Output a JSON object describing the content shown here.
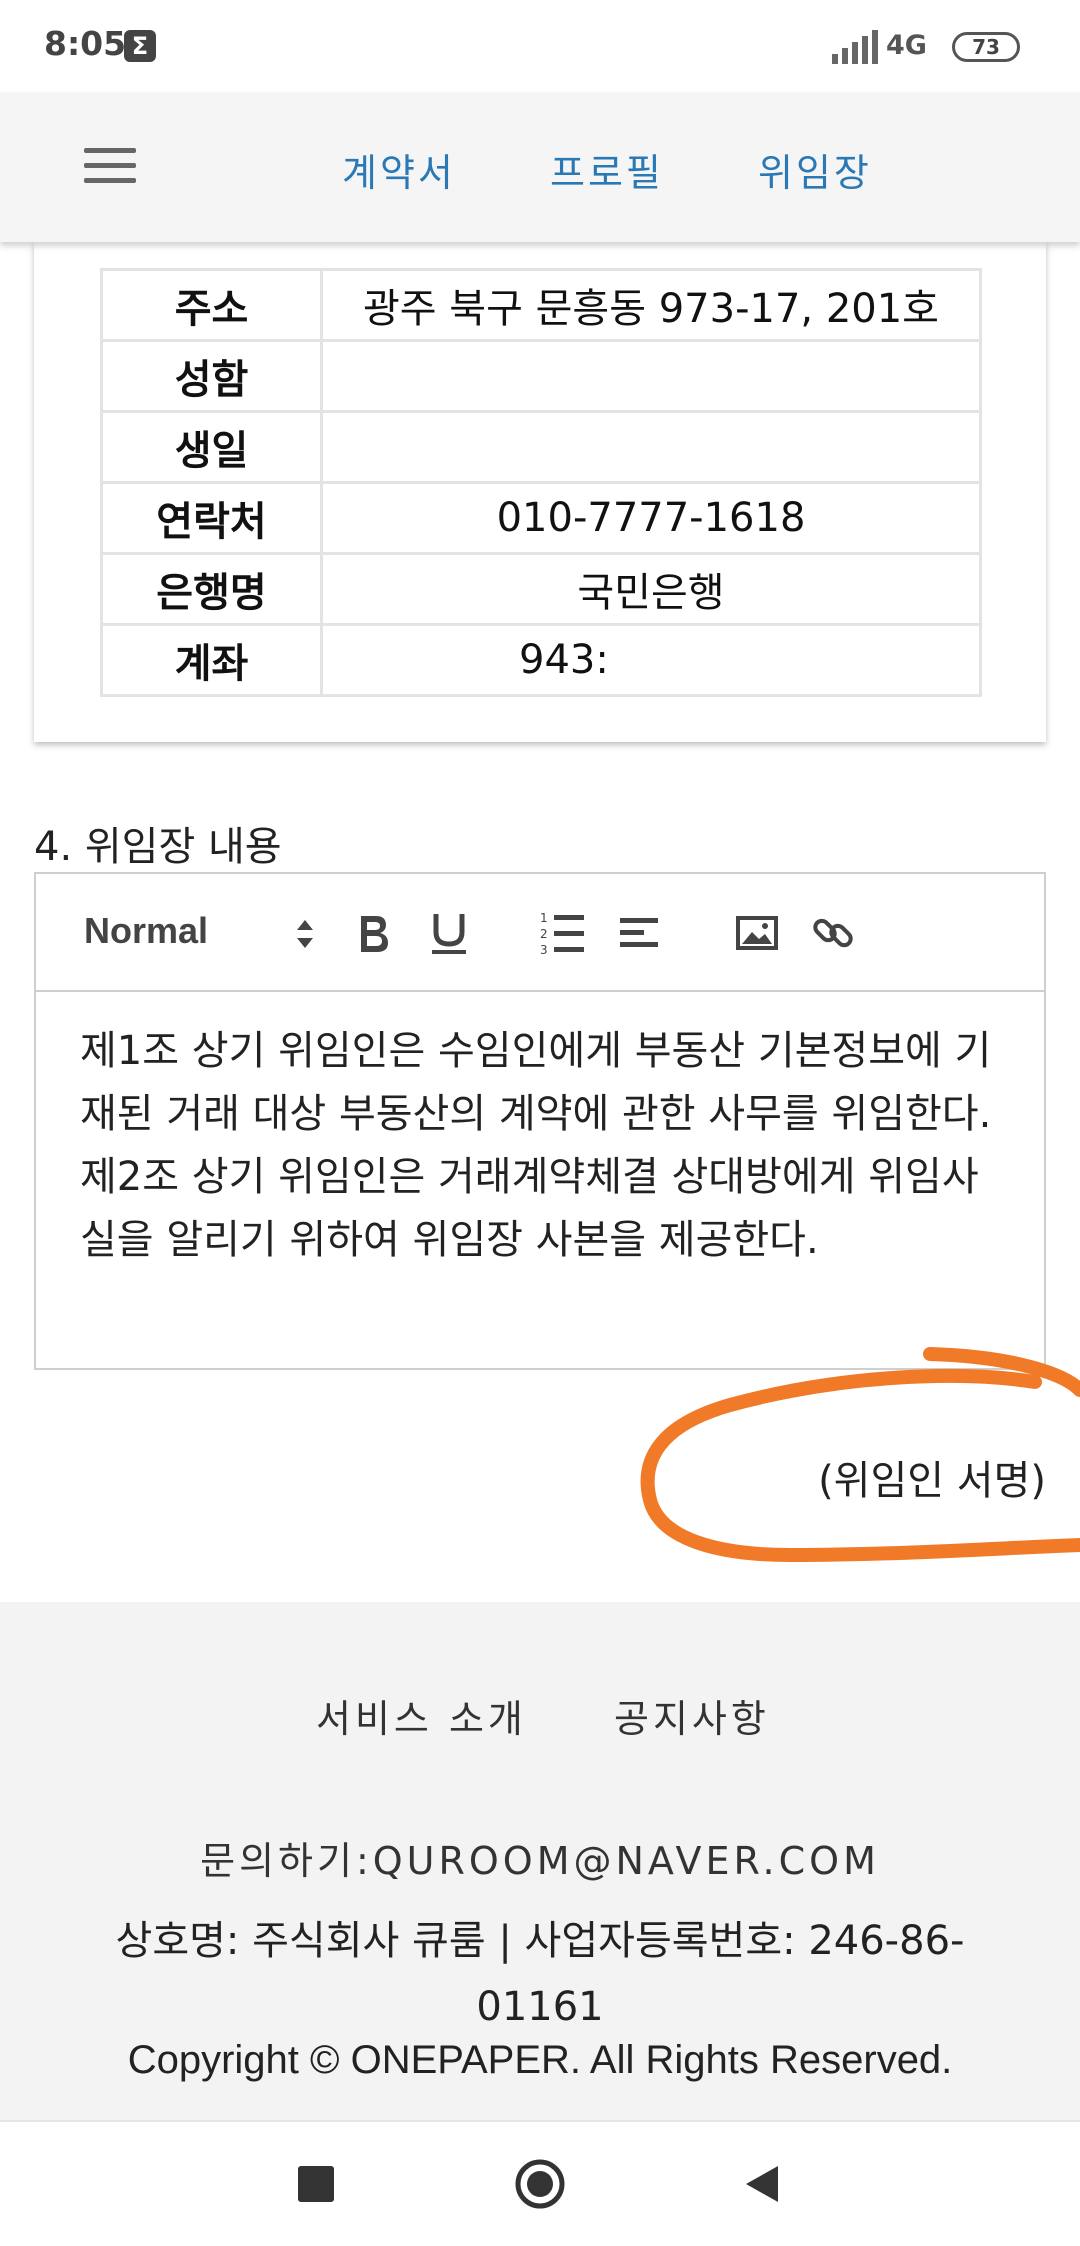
{
  "status_bar": {
    "time": "8:05",
    "notification_icon": "sigma-icon",
    "network": "4G",
    "battery": "73"
  },
  "header": {
    "menu_icon": "hamburger-icon",
    "tabs": [
      {
        "label": "계약서"
      },
      {
        "label": "프로필"
      },
      {
        "label": "위임장"
      }
    ],
    "tab_color": "#2a79b5"
  },
  "info_table": {
    "rows": [
      {
        "key": "주소",
        "value": "광주 북구 문흥동 973-17, 201호"
      },
      {
        "key": "성함",
        "value": ""
      },
      {
        "key": "생일",
        "value": ""
      },
      {
        "key": "연락처",
        "value": "010-7777-1618"
      },
      {
        "key": "은행명",
        "value": "국민은행"
      },
      {
        "key": "계좌",
        "value": "943:"
      }
    ]
  },
  "section": {
    "title": "4. 위임장 내용"
  },
  "editor": {
    "format_select": "Normal",
    "toolbar_icons": [
      "bold-icon",
      "underline-icon",
      "ordered-list-icon",
      "align-left-icon",
      "image-icon",
      "link-icon"
    ],
    "paragraphs": [
      "제1조 상기 위임인은 수임인에게 부동산 기본정보에 기재된 거래 대상 부동산의 계약에 관한 사무를 위임한다.",
      "제2조 상기 위임인은 거래계약체결 상대방에게 위임사실을 알리기 위하여 위임장 사본을 제공한다."
    ]
  },
  "signature": {
    "label": "(위임인 서명)",
    "highlight_color": "#f07a28"
  },
  "footer": {
    "links": [
      {
        "label": "서비스 소개"
      },
      {
        "label": "공지사항"
      }
    ],
    "contact": "문의하기:QUROOM@NAVER.COM",
    "company_line1": "상호명: 주식회사 큐룸 | 사업자등록번호: 246-86-",
    "company_line2": "01161",
    "copyright": "Copyright © ONEPAPER. All Rights Reserved."
  },
  "nav_bar": {
    "buttons": [
      "recents-icon",
      "home-icon",
      "back-icon"
    ]
  }
}
